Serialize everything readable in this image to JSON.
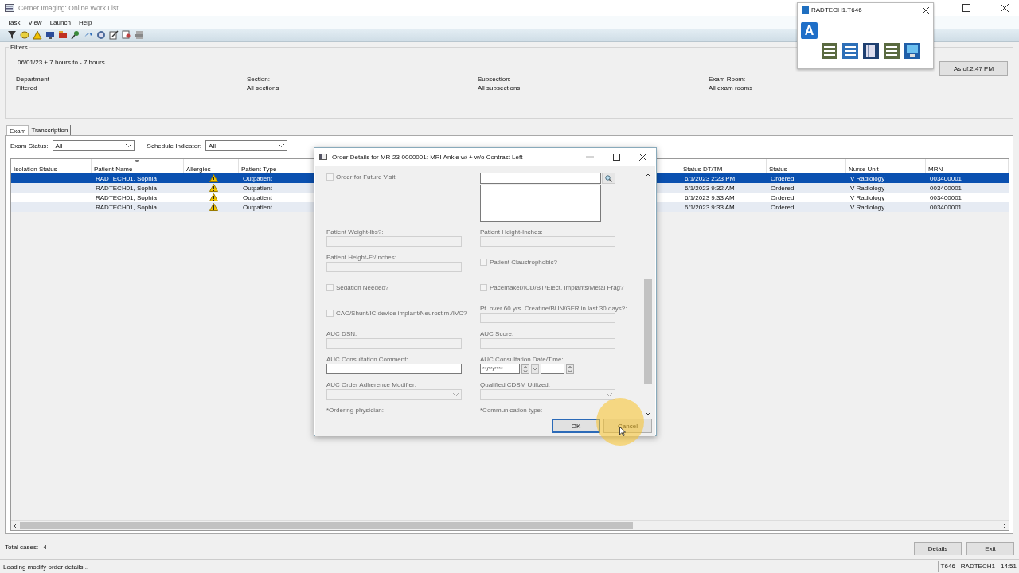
{
  "window": {
    "title": "Cerner Imaging: Online Work List"
  },
  "menu": [
    "Task",
    "View",
    "Launch",
    "Help"
  ],
  "filters": {
    "legend": "Filters",
    "range": "06/01/23 + 7 hours to - 7 hours",
    "as_of_button": "As of:2:47 PM",
    "items": [
      {
        "label": "Department",
        "value": "Filtered"
      },
      {
        "label": "Section:",
        "value": "All sections"
      },
      {
        "label": "Subsection:",
        "value": "All subsections"
      },
      {
        "label": "Exam Room:",
        "value": "All exam rooms"
      }
    ]
  },
  "tabs": [
    {
      "label": "Exam",
      "selected": true
    },
    {
      "label": "Transcription",
      "selected": false
    }
  ],
  "selectors": [
    {
      "label": "Exam Status:",
      "value": "All"
    },
    {
      "label": "Schedule Indicator:",
      "value": "All"
    }
  ],
  "table": {
    "columns": [
      {
        "label": "Isolation Status",
        "sorted": false
      },
      {
        "label": "Patient Name",
        "sorted": true
      },
      {
        "label": "Allergies",
        "sorted": false
      },
      {
        "label": "Patient Type",
        "sorted": false
      },
      {
        "label": "Status DT/TM",
        "sorted": false
      },
      {
        "label": "Status",
        "sorted": false
      },
      {
        "label": "Nurse Unit",
        "sorted": false
      },
      {
        "label": "MRN",
        "sorted": false
      }
    ],
    "rows": [
      {
        "selected": true,
        "patient_name": "RADTECH01, Sophia",
        "allergy_alert": true,
        "patient_type": "Outpatient",
        "status_dt_tm": "6/1/2023 2:23 PM",
        "status": "Ordered",
        "nurse_unit": "V Radiology",
        "mrn": "003400001"
      },
      {
        "selected": false,
        "patient_name": "RADTECH01, Sophia",
        "allergy_alert": true,
        "patient_type": "Outpatient",
        "status_dt_tm": "6/1/2023 9:32 AM",
        "status": "Ordered",
        "nurse_unit": "V Radiology",
        "mrn": "003400001"
      },
      {
        "selected": false,
        "patient_name": "RADTECH01, Sophia",
        "allergy_alert": true,
        "patient_type": "Outpatient",
        "status_dt_tm": "6/1/2023 9:33 AM",
        "status": "Ordered",
        "nurse_unit": "V Radiology",
        "mrn": "003400001"
      },
      {
        "selected": false,
        "patient_name": "RADTECH01, Sophia",
        "allergy_alert": true,
        "patient_type": "Outpatient",
        "status_dt_tm": "6/1/2023 9:33 AM",
        "status": "Ordered",
        "nurse_unit": "V Radiology",
        "mrn": "003400001"
      }
    ]
  },
  "footer": {
    "total_label": "Total cases:",
    "total_value": "4",
    "buttons": [
      "Details",
      "Exit"
    ]
  },
  "status_bar": {
    "message": "Loading modify order details...",
    "panels": [
      "T646",
      "RADTECH1",
      "14:51"
    ]
  },
  "mini_window": {
    "title": "RADTECH1.T646",
    "logo_letter": "A"
  },
  "dialog": {
    "title": "Order Details for MR-23-0000001: MRI Ankle w/ + w/o Contrast Left",
    "form": [
      {
        "kind": "checkbox",
        "label": "Order for Future Visit",
        "checked": false,
        "disabled": true
      },
      {
        "kind": "search_list"
      },
      {
        "kind": "field",
        "label": "Patient Weight-lbs?:",
        "disabled": true
      },
      {
        "kind": "field",
        "label": "Patient Height-Inches:",
        "disabled": true
      },
      {
        "kind": "field",
        "label": "Patient Height-Ft/Inches:",
        "disabled": true
      },
      {
        "kind": "checkbox",
        "label": "Patient Claustrophobic?",
        "checked": false,
        "disabled": true
      },
      {
        "kind": "checkbox",
        "label": "Sedation Needed?",
        "checked": false,
        "disabled": true
      },
      {
        "kind": "checkbox",
        "label": "Pacemaker/ICD/BT/Elect. Implants/Metal Frag?",
        "checked": false,
        "disabled": true
      },
      {
        "kind": "checkbox",
        "label": "CAC/Shunt/IC device implant/Neurostim./IVC?",
        "checked": false,
        "disabled": true
      },
      {
        "kind": "field",
        "label": "Pt. over 60 yrs. Creatine/BUN/GFR in last 30 days?:",
        "disabled": true
      },
      {
        "kind": "field",
        "label": "AUC DSN:",
        "disabled": true
      },
      {
        "kind": "field",
        "label": "AUC Score:",
        "disabled": true
      },
      {
        "kind": "field",
        "label": "AUC Consultation Comment:",
        "disabled": false
      },
      {
        "kind": "datetime",
        "label": "AUC Consultation Date/Time:",
        "value": "**/**/****"
      },
      {
        "kind": "combo",
        "label": "AUC Order Adherence Modifier:",
        "disabled": true
      },
      {
        "kind": "combo",
        "label": "Qualified CDSM Utilized:",
        "disabled": true
      },
      {
        "kind": "field",
        "label": "*Ordering physician:",
        "disabled": false
      },
      {
        "kind": "field",
        "label": "*Communication type:",
        "disabled": false
      }
    ],
    "buttons": [
      {
        "label": "OK",
        "focused": true
      },
      {
        "label": "Cancel",
        "focused": false
      }
    ]
  }
}
